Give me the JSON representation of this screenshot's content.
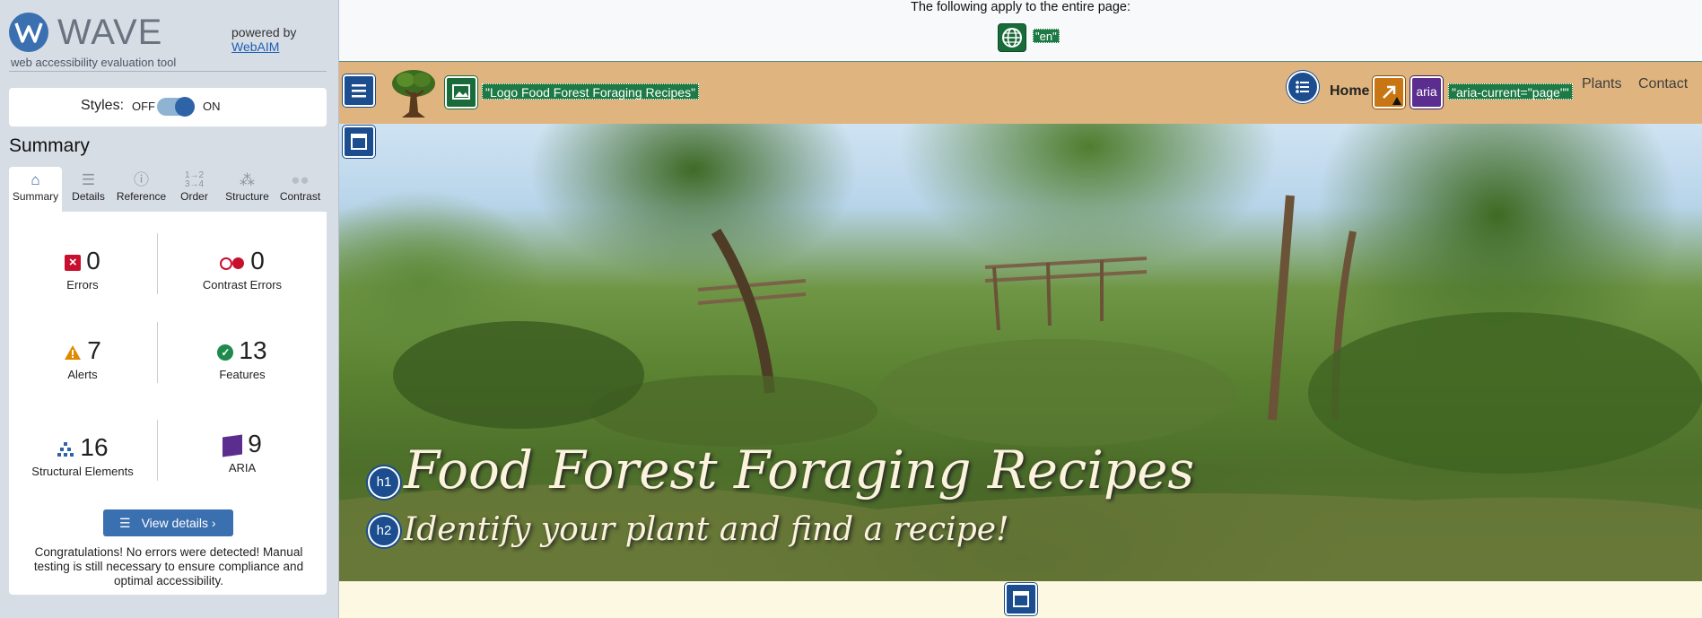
{
  "wave": {
    "brand": "WAVE",
    "tagline": "web accessibility evaluation tool",
    "powered_by": "powered by",
    "webaim_link": "WebAIM",
    "styles_label": "Styles:",
    "styles_off": "OFF",
    "styles_on": "ON",
    "styles_state": "on",
    "summary_title": "Summary",
    "tabs": [
      {
        "label": "Summary",
        "icon": "home-icon",
        "active": true
      },
      {
        "label": "Details",
        "icon": "list-icon",
        "active": false
      },
      {
        "label": "Reference",
        "icon": "info-icon",
        "active": false
      },
      {
        "label": "Order",
        "icon": "order-icon",
        "active": false
      },
      {
        "label": "Structure",
        "icon": "structure-icon",
        "active": false
      },
      {
        "label": "Contrast",
        "icon": "contrast-icon",
        "active": false
      }
    ],
    "stats": {
      "errors": {
        "value": "0",
        "label": "Errors"
      },
      "contrast_errors": {
        "value": "0",
        "label": "Contrast Errors"
      },
      "alerts": {
        "value": "7",
        "label": "Alerts"
      },
      "features": {
        "value": "13",
        "label": "Features"
      },
      "structural": {
        "value": "16",
        "label": "Structural Elements"
      },
      "aria": {
        "value": "9",
        "label": "ARIA"
      }
    },
    "view_details": "View details ›",
    "congrats": "Congratulations! No errors were detected! Manual testing is still necessary to ensure compliance and optimal accessibility."
  },
  "page": {
    "notice": "The following apply to the entire page:",
    "lang_tag": "\"en\"",
    "logo_alt_tag": "\"Logo Food Forest Foraging Recipes\"",
    "aria_current_tag": "\"aria-current=\"page\"\"",
    "aria_icon_label": "aria",
    "nav": {
      "home": "Home",
      "plants": "Plants",
      "contact": "Contact"
    },
    "hero_title": "Food Forest Foraging Recipes",
    "hero_subtitle": "Identify your plant and find a recipe!",
    "h1_badge": "h1",
    "h2_badge": "h2"
  },
  "colors": {
    "wave_blue": "#3a6fb0",
    "nav_bg": "#e0b47e",
    "feature_green": "#1d7a45",
    "error_red": "#c8102e",
    "alert_orange": "#e08a00",
    "aria_purple": "#5b2d8f"
  }
}
